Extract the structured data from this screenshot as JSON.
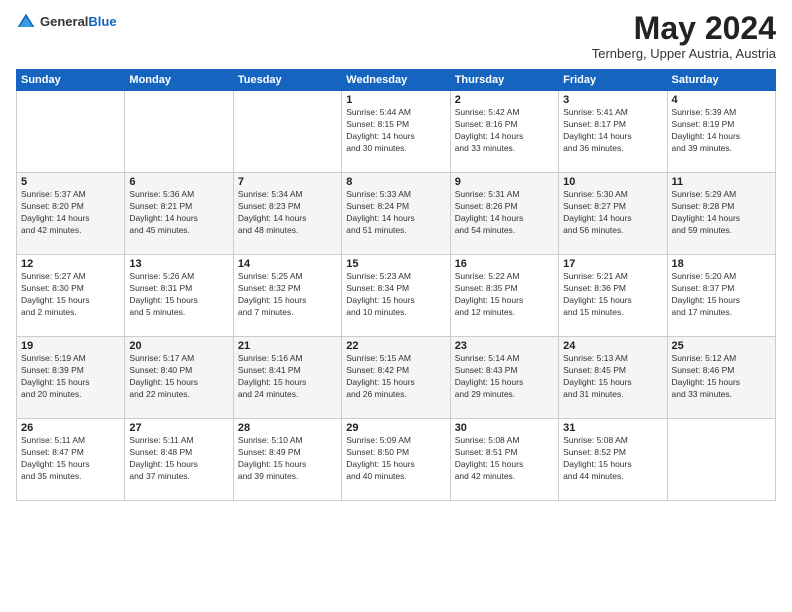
{
  "logo": {
    "general": "General",
    "blue": "Blue"
  },
  "title": "May 2024",
  "location": "Ternberg, Upper Austria, Austria",
  "days_header": [
    "Sunday",
    "Monday",
    "Tuesday",
    "Wednesday",
    "Thursday",
    "Friday",
    "Saturday"
  ],
  "weeks": [
    [
      {
        "day": "",
        "info": ""
      },
      {
        "day": "",
        "info": ""
      },
      {
        "day": "",
        "info": ""
      },
      {
        "day": "1",
        "info": "Sunrise: 5:44 AM\nSunset: 8:15 PM\nDaylight: 14 hours\nand 30 minutes."
      },
      {
        "day": "2",
        "info": "Sunrise: 5:42 AM\nSunset: 8:16 PM\nDaylight: 14 hours\nand 33 minutes."
      },
      {
        "day": "3",
        "info": "Sunrise: 5:41 AM\nSunset: 8:17 PM\nDaylight: 14 hours\nand 36 minutes."
      },
      {
        "day": "4",
        "info": "Sunrise: 5:39 AM\nSunset: 8:19 PM\nDaylight: 14 hours\nand 39 minutes."
      }
    ],
    [
      {
        "day": "5",
        "info": "Sunrise: 5:37 AM\nSunset: 8:20 PM\nDaylight: 14 hours\nand 42 minutes."
      },
      {
        "day": "6",
        "info": "Sunrise: 5:36 AM\nSunset: 8:21 PM\nDaylight: 14 hours\nand 45 minutes."
      },
      {
        "day": "7",
        "info": "Sunrise: 5:34 AM\nSunset: 8:23 PM\nDaylight: 14 hours\nand 48 minutes."
      },
      {
        "day": "8",
        "info": "Sunrise: 5:33 AM\nSunset: 8:24 PM\nDaylight: 14 hours\nand 51 minutes."
      },
      {
        "day": "9",
        "info": "Sunrise: 5:31 AM\nSunset: 8:26 PM\nDaylight: 14 hours\nand 54 minutes."
      },
      {
        "day": "10",
        "info": "Sunrise: 5:30 AM\nSunset: 8:27 PM\nDaylight: 14 hours\nand 56 minutes."
      },
      {
        "day": "11",
        "info": "Sunrise: 5:29 AM\nSunset: 8:28 PM\nDaylight: 14 hours\nand 59 minutes."
      }
    ],
    [
      {
        "day": "12",
        "info": "Sunrise: 5:27 AM\nSunset: 8:30 PM\nDaylight: 15 hours\nand 2 minutes."
      },
      {
        "day": "13",
        "info": "Sunrise: 5:26 AM\nSunset: 8:31 PM\nDaylight: 15 hours\nand 5 minutes."
      },
      {
        "day": "14",
        "info": "Sunrise: 5:25 AM\nSunset: 8:32 PM\nDaylight: 15 hours\nand 7 minutes."
      },
      {
        "day": "15",
        "info": "Sunrise: 5:23 AM\nSunset: 8:34 PM\nDaylight: 15 hours\nand 10 minutes."
      },
      {
        "day": "16",
        "info": "Sunrise: 5:22 AM\nSunset: 8:35 PM\nDaylight: 15 hours\nand 12 minutes."
      },
      {
        "day": "17",
        "info": "Sunrise: 5:21 AM\nSunset: 8:36 PM\nDaylight: 15 hours\nand 15 minutes."
      },
      {
        "day": "18",
        "info": "Sunrise: 5:20 AM\nSunset: 8:37 PM\nDaylight: 15 hours\nand 17 minutes."
      }
    ],
    [
      {
        "day": "19",
        "info": "Sunrise: 5:19 AM\nSunset: 8:39 PM\nDaylight: 15 hours\nand 20 minutes."
      },
      {
        "day": "20",
        "info": "Sunrise: 5:17 AM\nSunset: 8:40 PM\nDaylight: 15 hours\nand 22 minutes."
      },
      {
        "day": "21",
        "info": "Sunrise: 5:16 AM\nSunset: 8:41 PM\nDaylight: 15 hours\nand 24 minutes."
      },
      {
        "day": "22",
        "info": "Sunrise: 5:15 AM\nSunset: 8:42 PM\nDaylight: 15 hours\nand 26 minutes."
      },
      {
        "day": "23",
        "info": "Sunrise: 5:14 AM\nSunset: 8:43 PM\nDaylight: 15 hours\nand 29 minutes."
      },
      {
        "day": "24",
        "info": "Sunrise: 5:13 AM\nSunset: 8:45 PM\nDaylight: 15 hours\nand 31 minutes."
      },
      {
        "day": "25",
        "info": "Sunrise: 5:12 AM\nSunset: 8:46 PM\nDaylight: 15 hours\nand 33 minutes."
      }
    ],
    [
      {
        "day": "26",
        "info": "Sunrise: 5:11 AM\nSunset: 8:47 PM\nDaylight: 15 hours\nand 35 minutes."
      },
      {
        "day": "27",
        "info": "Sunrise: 5:11 AM\nSunset: 8:48 PM\nDaylight: 15 hours\nand 37 minutes."
      },
      {
        "day": "28",
        "info": "Sunrise: 5:10 AM\nSunset: 8:49 PM\nDaylight: 15 hours\nand 39 minutes."
      },
      {
        "day": "29",
        "info": "Sunrise: 5:09 AM\nSunset: 8:50 PM\nDaylight: 15 hours\nand 40 minutes."
      },
      {
        "day": "30",
        "info": "Sunrise: 5:08 AM\nSunset: 8:51 PM\nDaylight: 15 hours\nand 42 minutes."
      },
      {
        "day": "31",
        "info": "Sunrise: 5:08 AM\nSunset: 8:52 PM\nDaylight: 15 hours\nand 44 minutes."
      },
      {
        "day": "",
        "info": ""
      }
    ]
  ]
}
